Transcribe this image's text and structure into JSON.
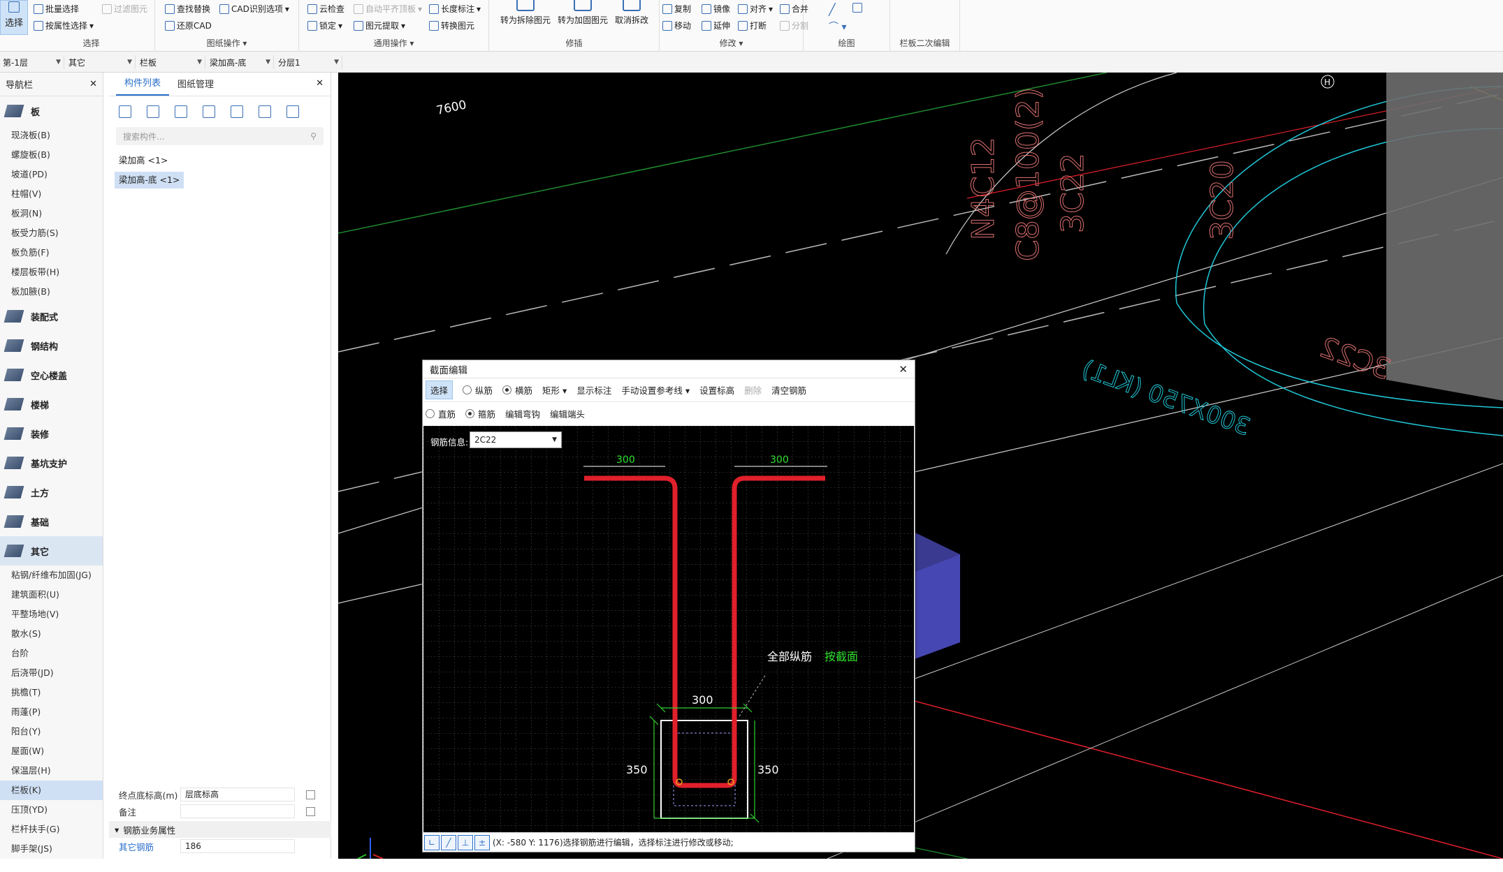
{
  "ribbon": {
    "select_label": "选择",
    "groups": {
      "select": "选择",
      "drawing_ops": "图纸操作",
      "general_ops": "通用操作",
      "modify_group": "修插",
      "modify": "修改",
      "draw": "绘图",
      "railing_edit": "栏板二次编辑"
    },
    "items": {
      "batch_select": "批量选择",
      "attr_select": "按属性选择",
      "filter": "过滤图元",
      "find_replace": "查找替换",
      "restore_cad": "还原CAD",
      "cad_options": "CAD识别选项",
      "cloud_check": "云检查",
      "auto_align": "自动平齐顶板",
      "length_mark": "长度标注",
      "lock": "锁定",
      "extract": "图元提取",
      "convert": "转换图元",
      "to_split": "转为拆除图元",
      "to_reinforce": "转为加固图元",
      "cancel_split": "取消拆改",
      "copy": "复制",
      "mirror": "镜像",
      "align": "对齐",
      "merge": "合并",
      "move": "移动",
      "extend": "延伸",
      "break": "打断",
      "split": "分割"
    }
  },
  "floorbar": {
    "floor": "第-1层",
    "type": "其它",
    "component": "栏板",
    "name": "梁加高-底",
    "layer": "分层1"
  },
  "nav": {
    "title": "导航栏",
    "cat_slab": "板",
    "slab_items": [
      "现浇板(B)",
      "螺旋板(B)",
      "坡道(PD)",
      "柱帽(V)",
      "板洞(N)",
      "板受力筋(S)",
      "板负筋(F)",
      "楼层板带(H)",
      "板加腋(B)"
    ],
    "cats": [
      "装配式",
      "钢结构",
      "空心楼盖",
      "楼梯",
      "装修",
      "基坑支护",
      "土方",
      "基础",
      "其它"
    ],
    "other_items": [
      "粘钢/纤维布加固(JG)",
      "建筑面积(U)",
      "平整场地(V)",
      "散水(S)",
      "台阶",
      "后浇带(JD)",
      "挑檐(T)",
      "雨蓬(P)",
      "阳台(Y)",
      "屋面(W)",
      "保温层(H)",
      "栏板(K)",
      "压顶(YD)",
      "栏杆扶手(G)",
      "脚手架(JS)"
    ]
  },
  "comp": {
    "tab_list": "构件列表",
    "tab_drawing": "图纸管理",
    "search_placeholder": "搜索构件...",
    "items": [
      "梁加高 <1>",
      "梁加高-底 <1>"
    ],
    "props": {
      "end_bottom_label": "终点底标高(m)",
      "end_bottom_value": "层底标高",
      "note_label": "备注",
      "note_value": "",
      "section_label": "钢筋业务属性",
      "other_rebar_label": "其它钢筋",
      "other_rebar_value": "186"
    }
  },
  "dialog": {
    "title": "截面编辑",
    "select": "选择",
    "longitudinal": "纵筋",
    "transverse": "横筋",
    "rect": "矩形",
    "show_mark": "显示标注",
    "manual_ref": "手动设置参考线",
    "set_elev": "设置标高",
    "delete": "删除",
    "clear": "清空钢筋",
    "straight": "直筋",
    "stirrup": "箍筋",
    "edit_hook": "编辑弯钩",
    "edit_end": "编辑端头",
    "rebar_info_label": "钢筋信息:",
    "rebar_info_value": "2C22",
    "dim_top_left": "300",
    "dim_top_right": "300",
    "dim_width": "300",
    "dim_h_left": "350",
    "dim_h_right": "350",
    "all_long": "全部纵筋",
    "by_section": "按截面",
    "status": "(X: -580 Y: 1176)选择钢筋进行编辑，选择标注进行修改或移动;"
  },
  "viewport": {
    "dim_7600": "7600",
    "label_n4c12": "N4C12",
    "label_c8": "C8@100(2)",
    "label_3c22": "3C22",
    "label_3c20": "3C20",
    "label_beam": "300X750 (KL1)",
    "label_3c22b": "3C22",
    "axis_h": "H"
  },
  "colors": {
    "accent": "#2a6fc9",
    "rebar": "#e0202a",
    "beam": "#3c3ca0",
    "cad_red": "#e07070",
    "cad_cyan": "#20c8d8"
  }
}
